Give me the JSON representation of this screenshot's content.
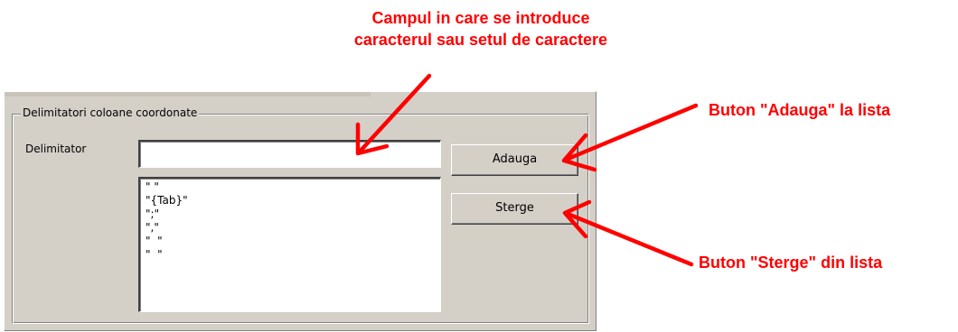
{
  "annotations": {
    "input_note_line1": "Campul in care se introduce",
    "input_note_line2": "caracterul sau setul de caractere",
    "add_note": "Buton \"Adauga\" la lista",
    "delete_note": "Buton \"Sterge\" din lista",
    "color": "#ff0000"
  },
  "groupbox": {
    "title": "Delimitatori coloane coordonate"
  },
  "delimiter": {
    "label": "Delimitator",
    "value": "",
    "placeholder": ""
  },
  "list": {
    "items": [
      "\" \"",
      "\"{Tab}\"",
      "\";\"",
      "\",\"",
      "\"  \"",
      "\"  \""
    ]
  },
  "buttons": {
    "add_label": "Adauga",
    "delete_label": "Sterge"
  },
  "colors": {
    "panel": "#d4d0c8",
    "annotation": "#ff0000"
  }
}
